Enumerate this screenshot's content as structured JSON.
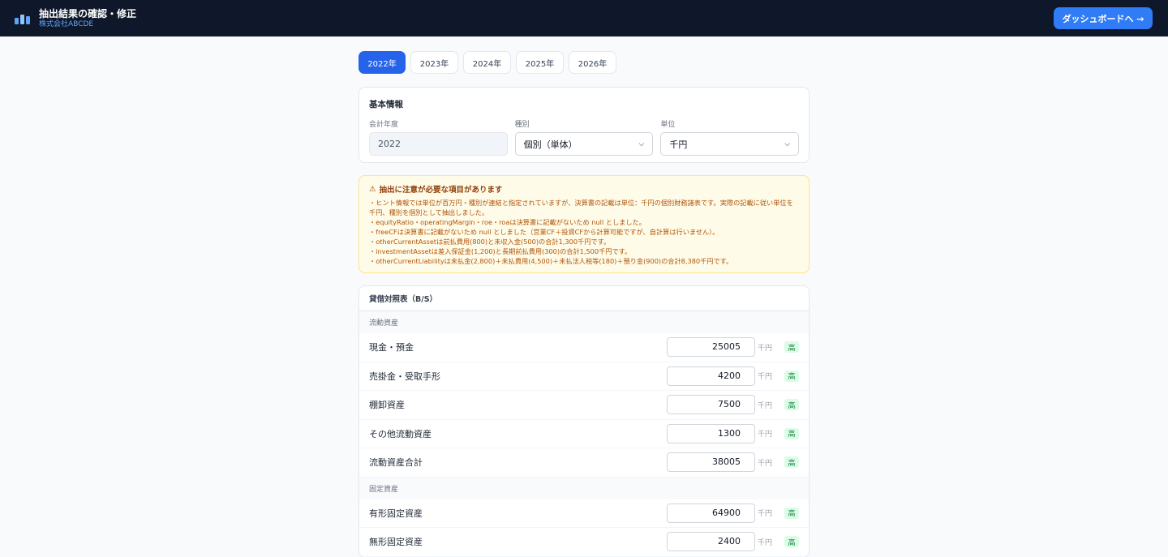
{
  "header": {
    "title": "抽出結果の確認・修正",
    "company": "株式会社ABCDE",
    "dashboard_button": "ダッシュボードへ →"
  },
  "year_tabs": [
    {
      "label": "2022年",
      "active": true
    },
    {
      "label": "2023年",
      "active": false
    },
    {
      "label": "2024年",
      "active": false
    },
    {
      "label": "2025年",
      "active": false
    },
    {
      "label": "2026年",
      "active": false
    }
  ],
  "basic_info": {
    "title": "基本情報",
    "fiscal_year_label": "会計年度",
    "fiscal_year_value": "2022",
    "type_label": "種別",
    "type_value": "個別（単体）",
    "unit_label": "単位",
    "unit_value": "千円"
  },
  "notice": {
    "icon": "warning-icon",
    "title": "抽出に注意が必要な項目があります",
    "lines": [
      "・ヒント情報では単位が百万円・種別が連結と指定されていますが、決算書の記載は単位：千円の個別財務諸表です。実際の記載に従い単位を千円、種別を個別として抽出しました。",
      "・equityRatio・operatingMargin・roe・roaは決算書に記載がないため null としました。",
      "・freeCFは決算書に記載がないため null としました（営業CF＋投資CFから計算可能ですが、自計算は行いません）。",
      "・otherCurrentAssetは前払費用(800)と未収入金(500)の合計1,300千円です。",
      "・investmentAssetは差入保証金(1,200)と長期前払費用(300)の合計1,500千円です。",
      "・otherCurrentLiabilityは未払金(2,800)＋未払費用(4,500)＋未払法人税等(180)＋預り金(900)の合計8,380千円です。"
    ]
  },
  "balance_sheet": {
    "title": "貸借対照表（B/S）",
    "unit": "千円",
    "badge": "高",
    "groups": [
      {
        "name": "流動資産",
        "rows": [
          {
            "label": "現金・預金",
            "value": "25005"
          },
          {
            "label": "売掛金・受取手形",
            "value": "4200"
          },
          {
            "label": "棚卸資産",
            "value": "7500"
          },
          {
            "label": "その他流動資産",
            "value": "1300"
          },
          {
            "label": "流動資産合計",
            "value": "38005"
          }
        ]
      },
      {
        "name": "固定資産",
        "rows": [
          {
            "label": "有形固定資産",
            "value": "64900"
          },
          {
            "label": "無形固定資産",
            "value": "2400"
          }
        ]
      }
    ]
  }
}
